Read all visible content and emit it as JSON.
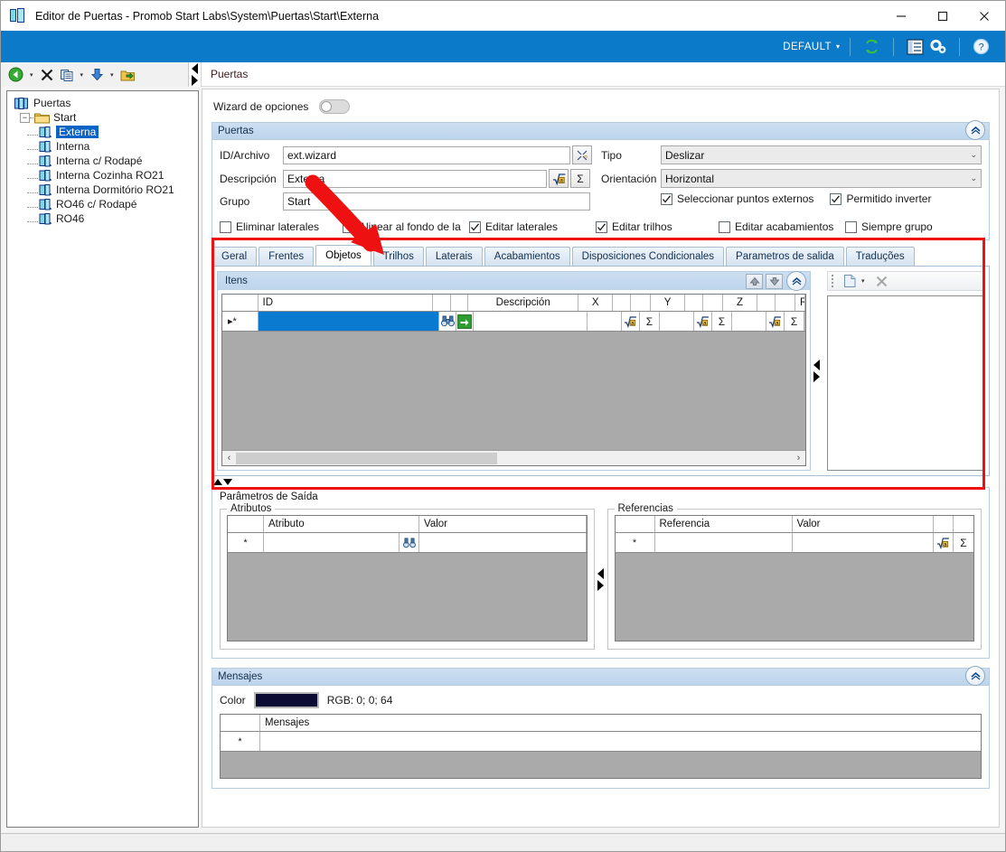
{
  "window": {
    "title": "Editor de Puertas - Promob Start Labs\\System\\Puertas\\Start\\Externa",
    "icon": "door-icon",
    "minimize": "−",
    "maximize": "□",
    "close": "✕"
  },
  "ribbon": {
    "profile_label": "DEFAULT",
    "caret": "▾",
    "icons": [
      "refresh-icon",
      "list-view-icon",
      "settings-gears-icon",
      "help-icon"
    ]
  },
  "toolbar": {
    "buttons": [
      "back-icon",
      "delete-icon",
      "copy-icon",
      "import-icon",
      "export-folder-icon"
    ],
    "breadcrumb": "Puertas"
  },
  "tree": {
    "root": "Puertas",
    "folder": "Start",
    "items": [
      {
        "label": "Externa",
        "selected": true
      },
      {
        "label": "Interna",
        "selected": false
      },
      {
        "label": "Interna c/ Rodapé",
        "selected": false
      },
      {
        "label": "Interna Cozinha RO21",
        "selected": false
      },
      {
        "label": "Interna Dormitório RO21",
        "selected": false
      },
      {
        "label": "RO46 c/ Rodapé",
        "selected": false
      },
      {
        "label": "RO46",
        "selected": false
      }
    ]
  },
  "wizard": {
    "label": "Wizard de opciones",
    "state": "off"
  },
  "puertas_group": {
    "title": "Puertas",
    "collapse_icon": "chevron-up-icon",
    "fields": {
      "id_archivo_label": "ID/Archivo",
      "id_archivo_value": "ext.wizard",
      "id_archivo_button": "browse-icon",
      "descripcion_label": "Descripción",
      "descripcion_value": "Externa",
      "descripcion_btn1": "formula-sqrt-icon",
      "descripcion_btn2": "sigma-icon",
      "grupo_label": "Grupo",
      "grupo_value": "Start",
      "tipo_label": "Tipo",
      "tipo_value": "Deslizar",
      "orientacion_label": "Orientación",
      "orientacion_value": "Horizontal"
    },
    "checkboxes": [
      {
        "label": "Eliminar laterales",
        "checked": false
      },
      {
        "label": "Alinear al fondo de la",
        "checked": false
      },
      {
        "label": "Editar laterales",
        "checked": true
      },
      {
        "label": "Seleccionar puntos externos",
        "checked": true
      },
      {
        "label": "Permitido inverter",
        "checked": true
      },
      {
        "label": "Editar trilhos",
        "checked": true
      },
      {
        "label": "Editar acabamientos",
        "checked": false
      },
      {
        "label": "Siempre grupo",
        "checked": false
      }
    ]
  },
  "tabs": [
    {
      "label": "Geral",
      "active": false
    },
    {
      "label": "Frentes",
      "active": false
    },
    {
      "label": "Objetos",
      "active": true
    },
    {
      "label": "Trilhos",
      "active": false
    },
    {
      "label": "Laterais",
      "active": false
    },
    {
      "label": "Acabamientos",
      "active": false
    },
    {
      "label": "Disposiciones Condicionales",
      "active": false
    },
    {
      "label": "Parametros de salida",
      "active": false
    },
    {
      "label": "Traduções",
      "active": false
    }
  ],
  "itens_panel": {
    "title": "Itens",
    "buttons": [
      "move-up-icon",
      "move-down-icon",
      "chevron-up-icon"
    ],
    "columns": [
      "",
      "ID",
      "",
      "",
      "Descripción",
      "X",
      "",
      "",
      "Y",
      "",
      "",
      "Z",
      "",
      "",
      "R"
    ],
    "row_marker": "▸*",
    "row_icons": [
      "binoculars-icon",
      "green-arrow-icon",
      "formula-sqrt-icon",
      "sigma-icon"
    ],
    "scroll_left": "‹",
    "scroll_right": "›"
  },
  "preview_panel": {
    "buttons": [
      "new-file-icon",
      "dropdown-caret-icon",
      "delete-x-icon"
    ]
  },
  "parametros_saida": {
    "title": "Parâmetros de Saída",
    "atributos": {
      "legend": "Atributos",
      "columns": [
        "",
        "Atributo",
        "Valor"
      ],
      "row_marker": "*",
      "icons": [
        "binoculars-icon"
      ]
    },
    "referencias": {
      "legend": "Referencias",
      "columns": [
        "",
        "Referencia",
        "Valor",
        "",
        ""
      ],
      "row_marker": "*",
      "icons": [
        "formula-sqrt-icon",
        "sigma-icon"
      ]
    }
  },
  "mensajes": {
    "title": "Mensajes",
    "collapse_icon": "chevron-up-icon",
    "color_label": "Color",
    "color_hex": "#0b0b33",
    "rgb_text": "RGB: 0; 0; 64",
    "columns": [
      "",
      "Mensajes"
    ],
    "row_marker": "*"
  },
  "annotation": {
    "highlight_color": "#ee1111",
    "arrow_color": "#ee1111",
    "target": "Objetos tab"
  }
}
